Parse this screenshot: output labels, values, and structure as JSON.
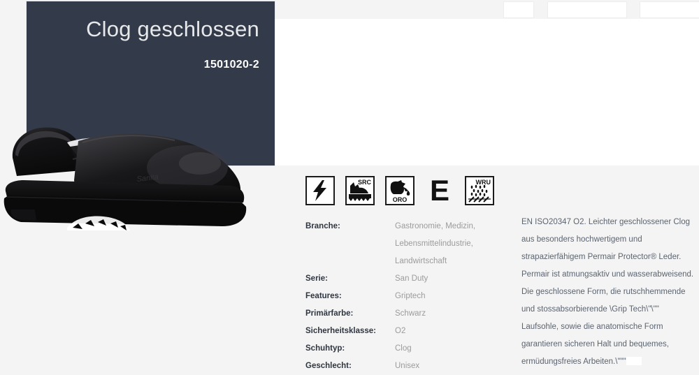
{
  "hero": {
    "title": "Clog geschlossen",
    "sku": "1501020-2",
    "bg_color": "#333a4a"
  },
  "topbar": {
    "field1_value": "",
    "field2_value": "",
    "field3_value": "",
    "field1_placeholder": "",
    "field2_placeholder": "",
    "field3_placeholder": ""
  },
  "product_image": {
    "alt": "Schwarzer geschlossener Clog, Seitenansicht",
    "brand_mark": "Sanita"
  },
  "pictograms": [
    {
      "name": "antistatic-lightning-icon",
      "label": "",
      "type": "bolt"
    },
    {
      "name": "src-slip-resistance-icon",
      "label": "SRC",
      "type": "src"
    },
    {
      "name": "oro-oil-resistance-icon",
      "label": "ORO",
      "type": "oro"
    },
    {
      "name": "energy-absorption-e-icon",
      "label": "E",
      "type": "e"
    },
    {
      "name": "wru-water-resistance-icon",
      "label": "WRU",
      "type": "wru"
    }
  ],
  "specs": [
    {
      "key": "Branche:",
      "values": [
        "Gastronomie, Medizin,",
        "Lebensmittelindustrie,",
        "Landwirtschaft"
      ]
    },
    {
      "key": "Serie:",
      "values": [
        "San Duty"
      ]
    },
    {
      "key": "Features:",
      "values": [
        "Griptech"
      ]
    },
    {
      "key": "Primärfarbe:",
      "values": [
        "Schwarz"
      ]
    },
    {
      "key": "Sicherheitsklasse:",
      "values": [
        "O2"
      ]
    },
    {
      "key": "Schuhtyp:",
      "values": [
        "Clog"
      ]
    },
    {
      "key": "Geschlecht:",
      "values": [
        "Unisex"
      ]
    }
  ],
  "description": {
    "text": "EN ISO20347 O2. Leichter geschlossener Clog aus besonders hochwertigem und strapazierfähigem Permair Protector® Leder. Permair ist atmungsaktiv und wasserabweisend. Die geschlossene Form, die rutschhemmende und stossabsorbierende \\Grip Tech\\\"\\\"\" Laufsohle, sowie die anatomische Form garantieren sicheren Halt und bequemes, ermüdungsfreies Arbeiten.\\\"\"\""
  },
  "colors": {
    "page_bg": "#f4f4f4",
    "panel_bg": "#ffffff",
    "hero_bg": "#333a4a",
    "key_text": "#2f3640",
    "value_text": "#9b9b9b",
    "desc_text": "#5b6470"
  }
}
